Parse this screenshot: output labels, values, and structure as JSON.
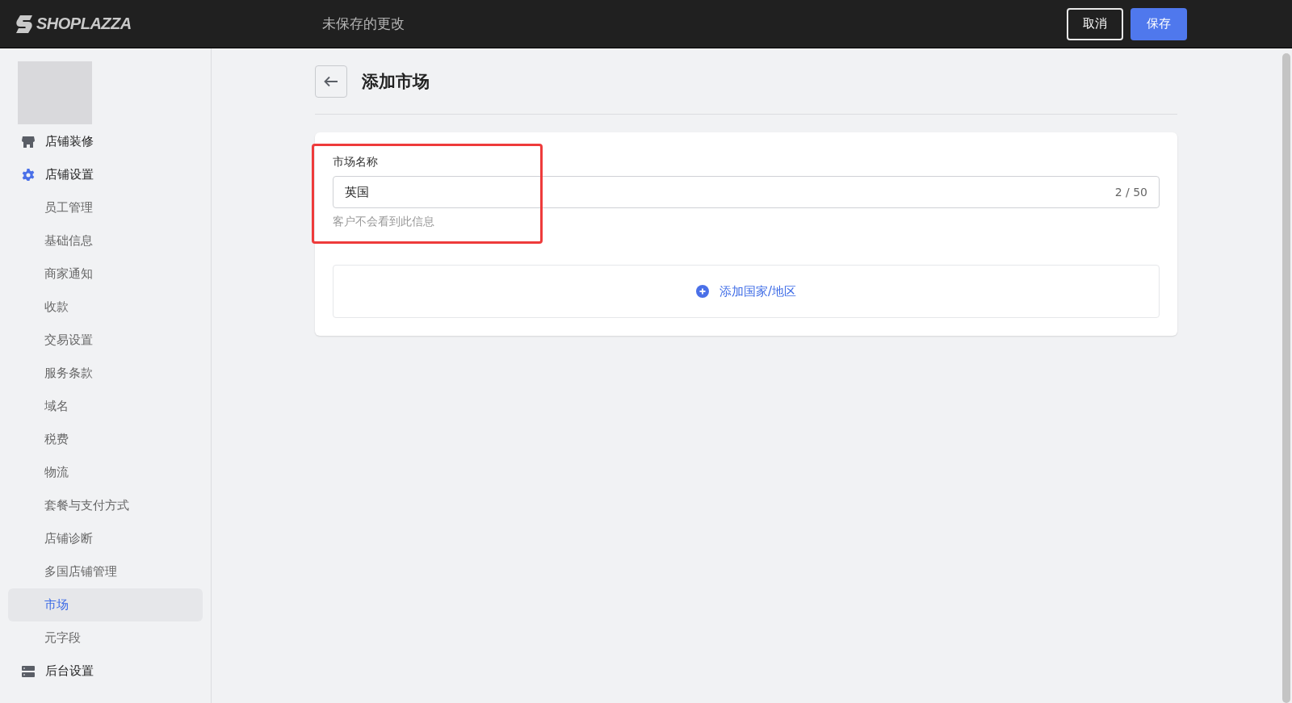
{
  "top_bar": {
    "logo": "SHOPLAZZA",
    "title": "未保存的更改",
    "buttons": [
      {
        "label": "取消",
        "kind": "secondary"
      },
      {
        "label": "保存",
        "kind": "primary"
      }
    ]
  },
  "sidebar": {
    "items": [
      {
        "label": "店铺装修",
        "kind": "store",
        "expanded": false
      },
      {
        "label": "店铺设置",
        "kind": "gear",
        "expanded": true,
        "children": [
          {
            "label": "员工管理",
            "selected": false
          },
          {
            "label": "基础信息",
            "selected": false
          },
          {
            "label": "商家通知",
            "selected": false
          },
          {
            "label": "收款",
            "selected": false
          },
          {
            "label": "交易设置",
            "selected": false
          },
          {
            "label": "服务条款",
            "selected": false
          },
          {
            "label": "域名",
            "selected": false
          },
          {
            "label": "税费",
            "selected": false
          },
          {
            "label": "物流",
            "selected": false
          },
          {
            "label": "套餐与支付方式",
            "selected": false
          },
          {
            "label": "店铺诊断",
            "selected": false
          },
          {
            "label": "多国店铺管理",
            "selected": false
          },
          {
            "label": "市场",
            "selected": true
          },
          {
            "label": "元字段",
            "selected": false
          }
        ]
      },
      {
        "label": "后台设置",
        "kind": "server",
        "expanded": false
      }
    ]
  },
  "page": {
    "title": "添加市场"
  },
  "form": {
    "highlighted": true,
    "label": "市场名称",
    "value": "英国",
    "counter": "2 / 50",
    "help": "客户不会看到此信息",
    "add_link": "添加国家/地区"
  }
}
